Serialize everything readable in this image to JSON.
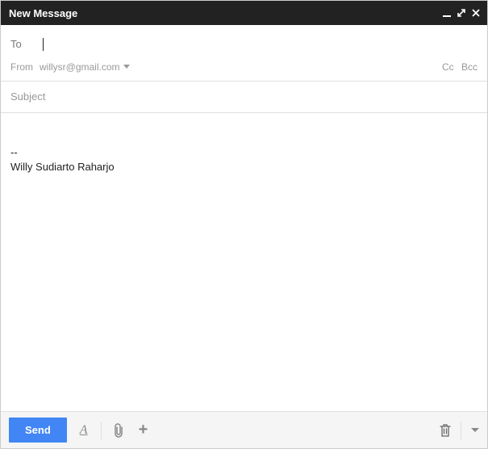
{
  "titlebar": {
    "title": "New Message"
  },
  "recipients": {
    "to_label": "To",
    "to_value": "",
    "from_label": "From",
    "from_address": "willysr@gmail.com",
    "cc_label": "Cc",
    "bcc_label": "Bcc"
  },
  "subject": {
    "placeholder": "Subject",
    "value": ""
  },
  "body": {
    "signature_separator": "--",
    "signature_name": "Willy Sudiarto Raharjo"
  },
  "toolbar": {
    "send_label": "Send",
    "format_glyph": "A",
    "insert_glyph": "+"
  }
}
